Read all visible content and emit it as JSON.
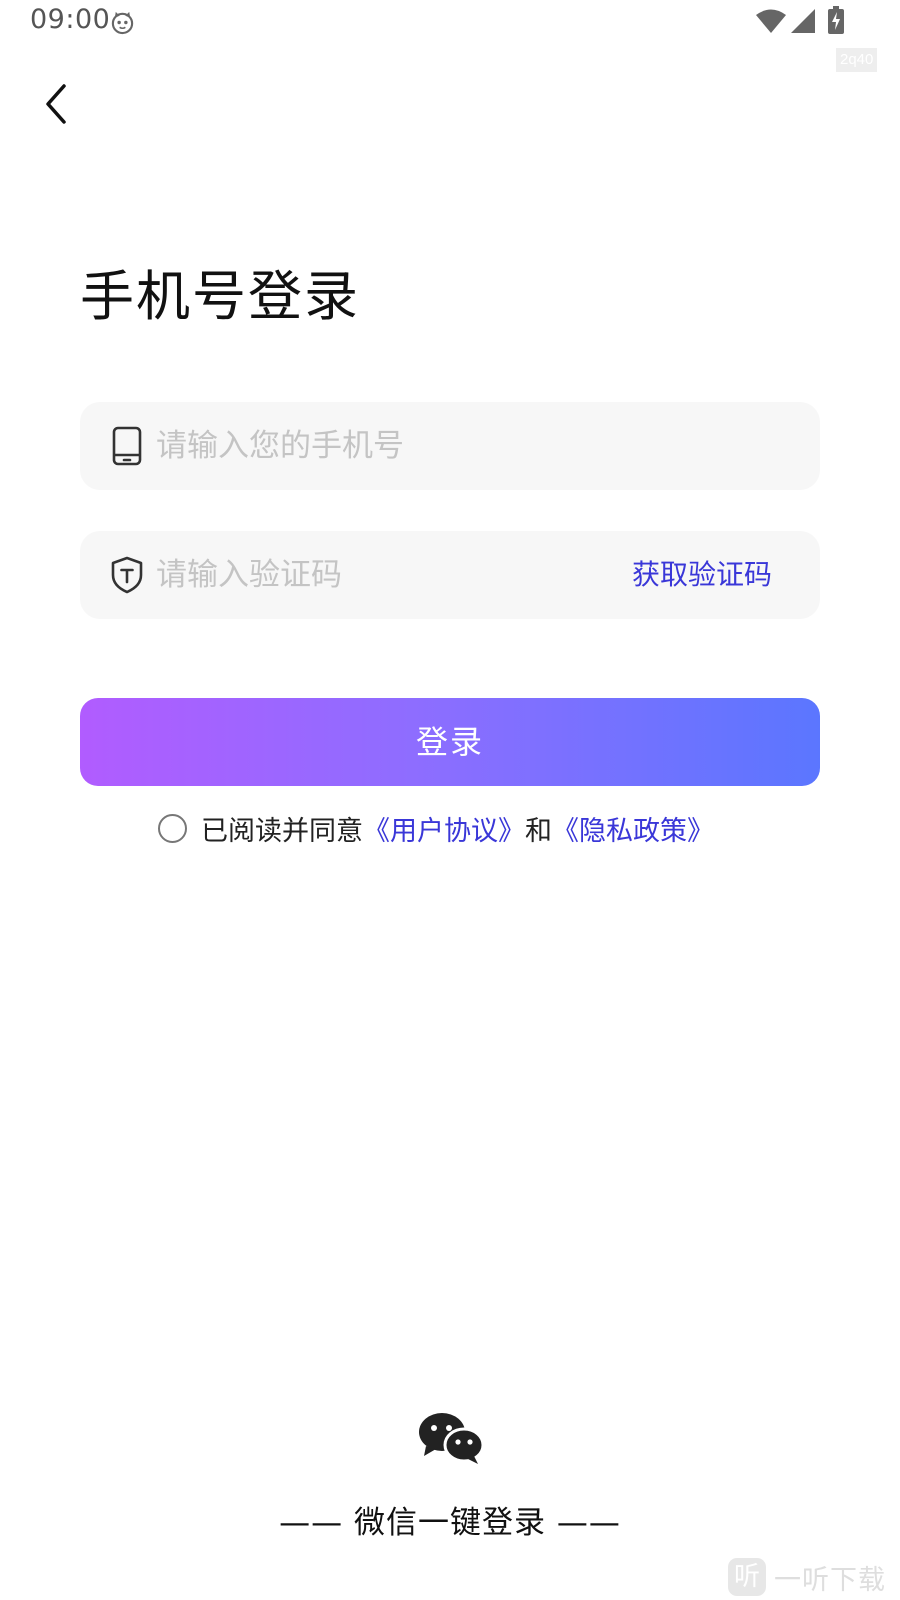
{
  "status_bar": {
    "time": "09:00",
    "app_icon": "cat-face-icon",
    "wifi_icon": "wifi-icon",
    "signal_icon": "signal-icon",
    "battery_icon": "battery-charging-icon",
    "code_tag": "2q40"
  },
  "header": {
    "back_icon": "chevron-left-icon"
  },
  "title": "手机号登录",
  "phone_field": {
    "icon": "phone-icon",
    "value": "",
    "placeholder": "请输入您的手机号"
  },
  "code_field": {
    "icon": "shield-icon",
    "value": "",
    "placeholder": "请输入验证码",
    "get_code_label": "获取验证码"
  },
  "login_button": {
    "label": "登录",
    "gradient_start": "#b15cff",
    "gradient_end": "#5b76ff"
  },
  "agreement": {
    "checked": false,
    "prefix": "已阅读并同意",
    "user_agreement": "《用户协议》",
    "conjunction": "和",
    "privacy_policy": "《隐私政策》"
  },
  "wechat": {
    "icon": "wechat-icon",
    "label": "—— 微信一键登录 ——"
  },
  "corner_watermark": {
    "logo_text": "听",
    "text": "一听下载"
  },
  "colors": {
    "link": "#3a37d8",
    "field_bg": "#f7f7f7",
    "placeholder": "#c4c4c4"
  }
}
